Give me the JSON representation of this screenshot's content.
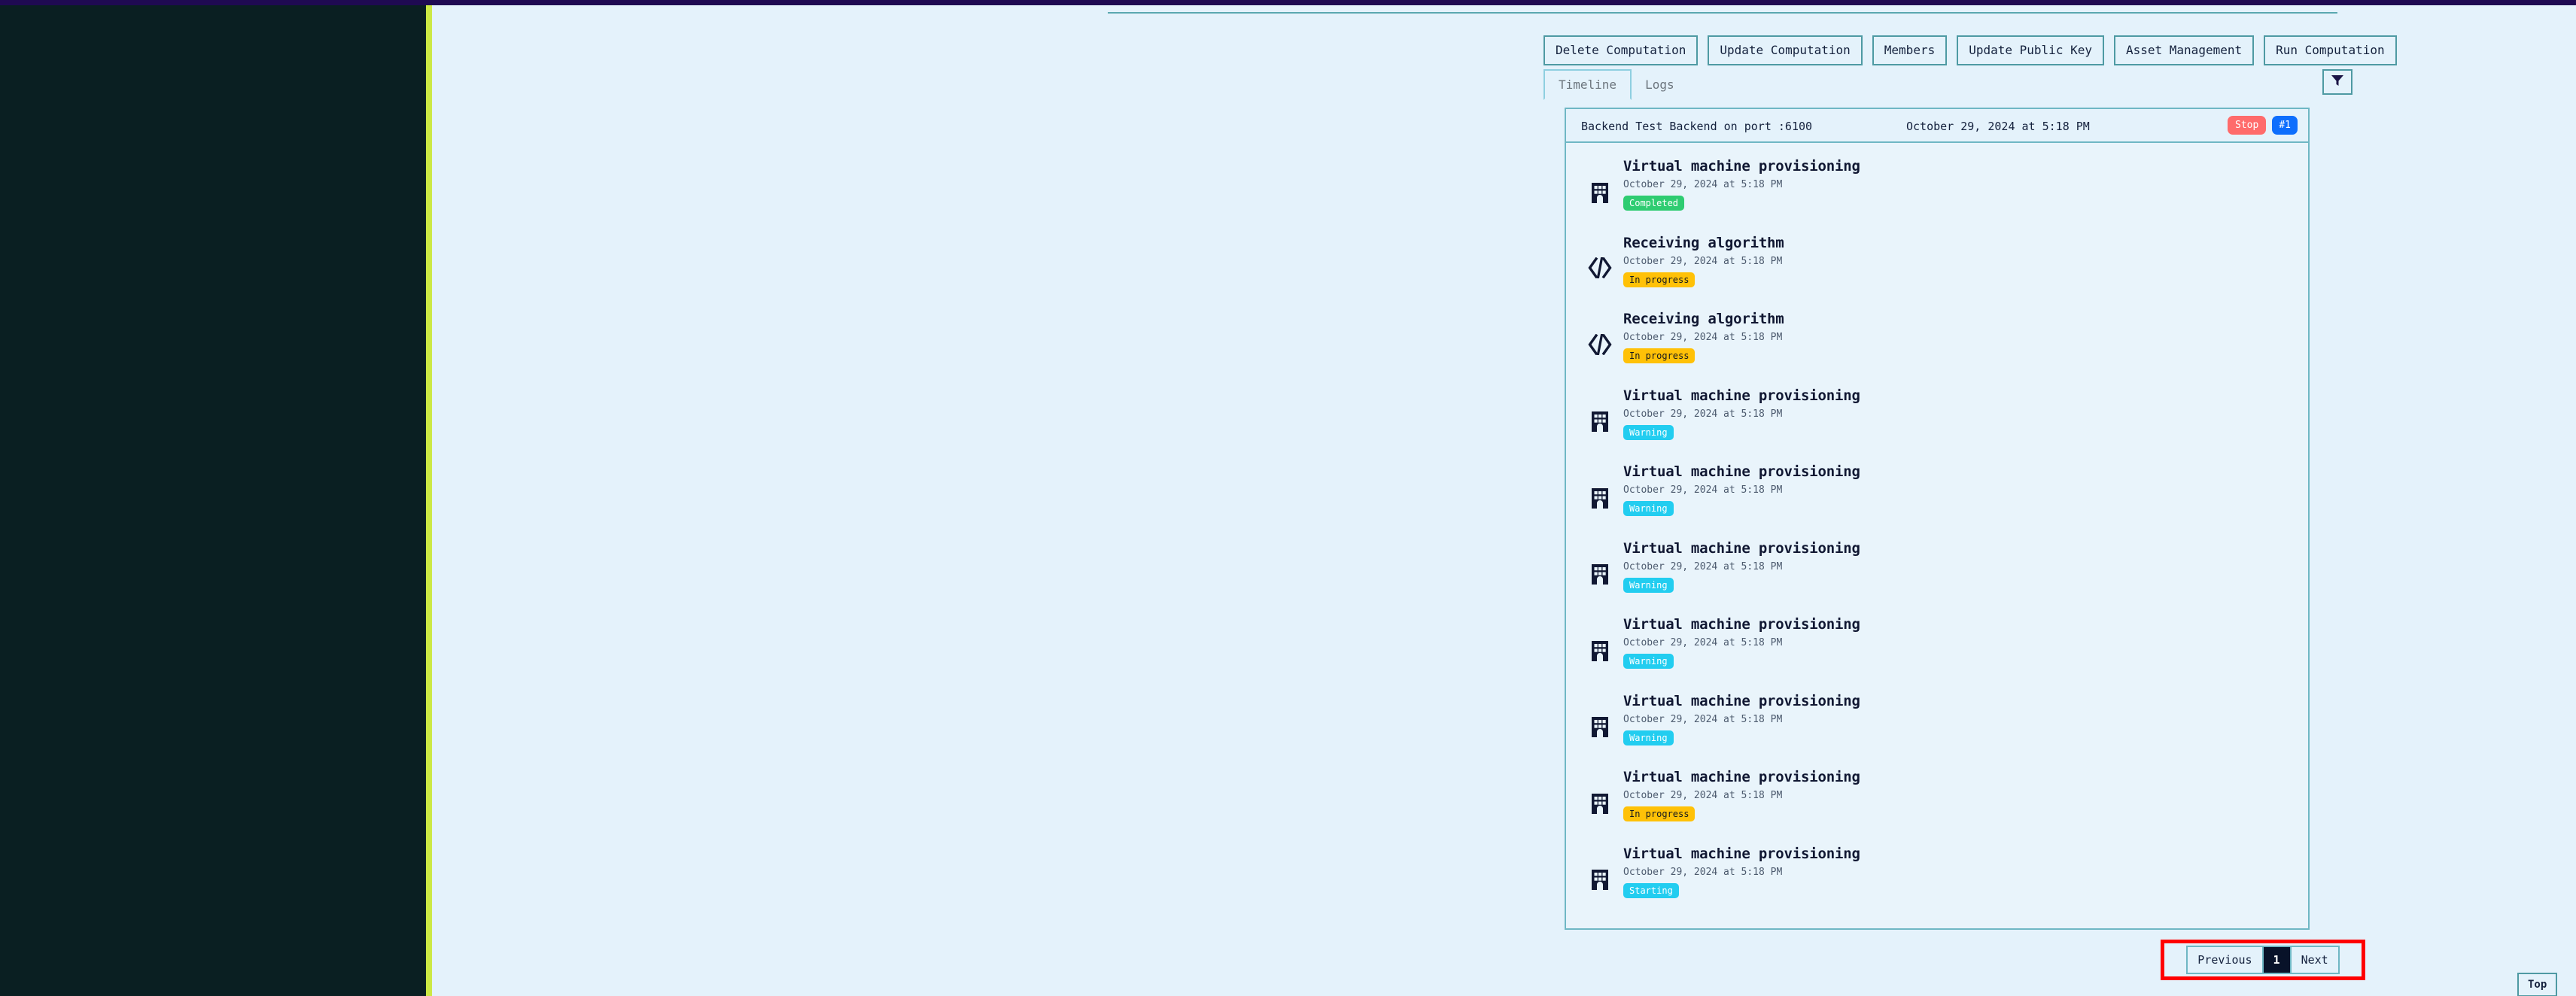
{
  "theme": {
    "sidebar_bg": "#0a1f22",
    "sidebar_accent": "#cce844",
    "top_strip": "#1f0a52",
    "page_bg": "#e4f2fb",
    "border_teal": "#6fb7c4",
    "highlight_red": "#ff0000"
  },
  "header": {
    "label": "Backend",
    "value": "Test Backend"
  },
  "actions": [
    {
      "label": "Delete Computation",
      "name": "delete-computation-button"
    },
    {
      "label": "Update Computation",
      "name": "update-computation-button"
    },
    {
      "label": "Members",
      "name": "members-button"
    },
    {
      "label": "Update Public Key",
      "name": "update-public-key-button"
    },
    {
      "label": "Asset Management",
      "name": "asset-management-button"
    },
    {
      "label": "Run Computation",
      "name": "run-computation-button"
    }
  ],
  "tabs": [
    {
      "label": "Timeline",
      "active": true
    },
    {
      "label": "Logs",
      "active": false
    }
  ],
  "filter": {
    "icon": "filter-icon"
  },
  "card": {
    "title": "Backend Test Backend on port :6100",
    "date": "October 29, 2024 at 5:18 PM",
    "stop_label": "Stop",
    "run_badge": "#1"
  },
  "timeline": [
    {
      "icon": "building-icon",
      "title": "Virtual machine provisioning",
      "date": "October 29, 2024 at 5:18 PM",
      "status": "Completed",
      "status_class": "st-completed"
    },
    {
      "icon": "code-icon",
      "title": "Receiving algorithm",
      "date": "October 29, 2024 at 5:18 PM",
      "status": "In progress",
      "status_class": "st-inprogress"
    },
    {
      "icon": "code-icon",
      "title": "Receiving algorithm",
      "date": "October 29, 2024 at 5:18 PM",
      "status": "In progress",
      "status_class": "st-inprogress"
    },
    {
      "icon": "building-icon",
      "title": "Virtual machine provisioning",
      "date": "October 29, 2024 at 5:18 PM",
      "status": "Warning",
      "status_class": "st-warning"
    },
    {
      "icon": "building-icon",
      "title": "Virtual machine provisioning",
      "date": "October 29, 2024 at 5:18 PM",
      "status": "Warning",
      "status_class": "st-warning"
    },
    {
      "icon": "building-icon",
      "title": "Virtual machine provisioning",
      "date": "October 29, 2024 at 5:18 PM",
      "status": "Warning",
      "status_class": "st-warning"
    },
    {
      "icon": "building-icon",
      "title": "Virtual machine provisioning",
      "date": "October 29, 2024 at 5:18 PM",
      "status": "Warning",
      "status_class": "st-warning"
    },
    {
      "icon": "building-icon",
      "title": "Virtual machine provisioning",
      "date": "October 29, 2024 at 5:18 PM",
      "status": "Warning",
      "status_class": "st-warning"
    },
    {
      "icon": "building-icon",
      "title": "Virtual machine provisioning",
      "date": "October 29, 2024 at 5:18 PM",
      "status": "In progress",
      "status_class": "st-inprogress"
    },
    {
      "icon": "building-icon",
      "title": "Virtual machine provisioning",
      "date": "October 29, 2024 at 5:18 PM",
      "status": "Starting",
      "status_class": "st-starting"
    }
  ],
  "pagination": {
    "previous_label": "Previous",
    "current_page": "1",
    "next_label": "Next"
  },
  "scroll_top": {
    "label": "Top"
  }
}
